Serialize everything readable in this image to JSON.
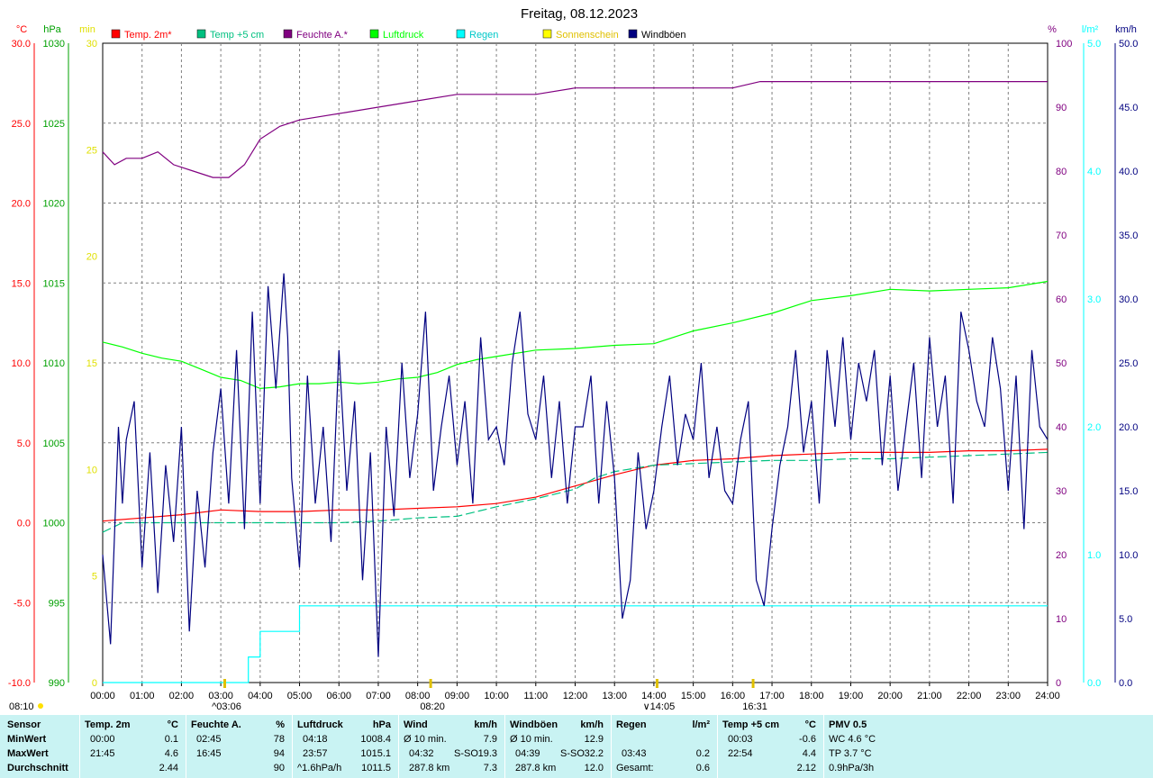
{
  "chart_data": {
    "type": "line",
    "title": "Freitag, 08.12.2023",
    "x_ticks": [
      "00:00",
      "01:00",
      "02:00",
      "03:00",
      "04:00",
      "05:00",
      "06:00",
      "07:00",
      "08:00",
      "09:00",
      "10:00",
      "11:00",
      "12:00",
      "13:00",
      "14:00",
      "15:00",
      "16:00",
      "17:00",
      "18:00",
      "19:00",
      "20:00",
      "21:00",
      "22:00",
      "23:00",
      "24:00"
    ],
    "xlim": [
      0,
      24
    ],
    "axes": {
      "temp": {
        "unit": "°C",
        "color": "#ff0000",
        "ylim": [
          -10,
          30
        ],
        "ticks": [
          "30.0",
          "25.0",
          "20.0",
          "15.0",
          "10.0",
          "5.0",
          "0.0",
          "-5.0",
          "-10.0"
        ]
      },
      "pressure": {
        "unit": "hPa",
        "color": "#00a000",
        "ylim": [
          990,
          1030
        ],
        "ticks": [
          "1030",
          "1025",
          "1020",
          "1015",
          "1010",
          "1005",
          "1000",
          "995",
          "990"
        ]
      },
      "sunshine": {
        "unit": "min",
        "color": "#e0e000",
        "ylim": [
          0,
          30
        ],
        "ticks": [
          "30",
          "25",
          "20",
          "15",
          "10",
          "5",
          "0"
        ]
      },
      "humidity": {
        "unit": "%",
        "color": "#800080",
        "ylim": [
          0,
          100
        ],
        "ticks": [
          "100",
          "90",
          "80",
          "70",
          "60",
          "50",
          "40",
          "30",
          "20",
          "10",
          "0"
        ]
      },
      "rain": {
        "unit": "l/m²",
        "color": "#00ffff",
        "ylim": [
          0,
          5
        ],
        "ticks": [
          "5.0",
          "4.0",
          "3.0",
          "2.0",
          "1.0",
          "0.0"
        ]
      },
      "wind": {
        "unit": "km/h",
        "color": "#000080",
        "ylim": [
          0,
          50
        ],
        "ticks": [
          "50.0",
          "45.0",
          "40.0",
          "35.0",
          "30.0",
          "25.0",
          "20.0",
          "15.0",
          "10.0",
          "5.0",
          "0.0"
        ]
      }
    },
    "legend": [
      {
        "label": "Temp. 2m*",
        "color": "#ff0000"
      },
      {
        "label": "Temp +5 cm",
        "color": "#00c080"
      },
      {
        "label": "Feuchte A.*",
        "color": "#800080"
      },
      {
        "label": "Luftdruck",
        "color": "#00ff00"
      },
      {
        "label": "Regen",
        "color": "#00ffff"
      },
      {
        "label": "Sonnenschein",
        "color": "#ffff00"
      },
      {
        "label": "Windböen",
        "color": "#000080"
      }
    ],
    "series": [
      {
        "name": "Temp. 2m*",
        "axis": "temp",
        "color": "#ff0000",
        "x": [
          0,
          1,
          2,
          3,
          4,
          5,
          6,
          7,
          8,
          9,
          10,
          11,
          12,
          13,
          14,
          15,
          16,
          17,
          18,
          19,
          20,
          21,
          22,
          23,
          24
        ],
        "values": [
          0.1,
          0.3,
          0.5,
          0.8,
          0.7,
          0.7,
          0.8,
          0.8,
          0.9,
          1.0,
          1.2,
          1.6,
          2.3,
          3.0,
          3.6,
          3.9,
          4.0,
          4.2,
          4.3,
          4.4,
          4.4,
          4.4,
          4.5,
          4.5,
          4.6
        ]
      },
      {
        "name": "Temp +5 cm",
        "axis": "temp",
        "color": "#00c080",
        "x": [
          0,
          0.5,
          1,
          2,
          3,
          4,
          5,
          6,
          7,
          8,
          9,
          10,
          11,
          12,
          12.5,
          13,
          14,
          15,
          16,
          17,
          18,
          19,
          20,
          21,
          22,
          23,
          24
        ],
        "values": [
          -0.6,
          0.0,
          0.0,
          0.0,
          0.0,
          0.0,
          0.0,
          0.0,
          0.1,
          0.3,
          0.4,
          1.0,
          1.5,
          2.1,
          2.8,
          3.2,
          3.6,
          3.7,
          3.8,
          3.9,
          3.9,
          4.0,
          4.0,
          4.1,
          4.2,
          4.3,
          4.4
        ]
      },
      {
        "name": "Feuchte A.*",
        "axis": "humidity",
        "color": "#800080",
        "x": [
          0,
          0.3,
          0.6,
          1,
          1.4,
          1.8,
          2.3,
          2.8,
          3.2,
          3.6,
          4,
          4.5,
          5,
          6,
          7,
          8,
          9,
          10,
          11,
          12,
          13,
          14,
          15,
          16,
          16.7,
          17,
          18,
          19,
          20,
          21,
          22,
          23,
          24
        ],
        "values": [
          83,
          81,
          82,
          82,
          83,
          81,
          80,
          79,
          79,
          81,
          85,
          87,
          88,
          89,
          90,
          91,
          92,
          92,
          92,
          93,
          93,
          93,
          93,
          93,
          94,
          94,
          94,
          94,
          94,
          94,
          94,
          94,
          94
        ]
      },
      {
        "name": "Luftdruck",
        "axis": "pressure",
        "color": "#00ff00",
        "x": [
          0,
          0.5,
          1,
          1.5,
          2,
          2.5,
          3,
          3.5,
          4,
          4.5,
          5,
          5.5,
          6,
          6.5,
          7,
          7.5,
          8,
          8.5,
          9,
          9.5,
          10,
          11,
          12,
          13,
          14,
          15,
          16,
          17,
          18,
          19,
          20,
          21,
          22,
          23,
          24
        ],
        "values": [
          1011.3,
          1011.0,
          1010.6,
          1010.3,
          1010.1,
          1009.6,
          1009.1,
          1008.9,
          1008.4,
          1008.5,
          1008.7,
          1008.7,
          1008.8,
          1008.7,
          1008.8,
          1009.0,
          1009.1,
          1009.4,
          1009.9,
          1010.2,
          1010.4,
          1010.8,
          1010.9,
          1011.1,
          1011.2,
          1012.0,
          1012.5,
          1013.1,
          1013.9,
          1014.2,
          1014.6,
          1014.5,
          1014.6,
          1014.7,
          1015.1
        ]
      },
      {
        "name": "Regen",
        "axis": "rain",
        "color": "#00ffff",
        "step": true,
        "x": [
          0,
          3.7,
          3.7,
          4.0,
          4.0,
          5.0,
          5.0,
          24
        ],
        "values": [
          0,
          0,
          0.2,
          0.2,
          0.4,
          0.4,
          0.6,
          0.6
        ]
      },
      {
        "name": "Windböen",
        "axis": "wind",
        "color": "#000080",
        "x": [
          0,
          0.2,
          0.4,
          0.5,
          0.6,
          0.8,
          1,
          1.2,
          1.4,
          1.6,
          1.8,
          2,
          2.2,
          2.4,
          2.6,
          2.8,
          3,
          3.2,
          3.4,
          3.6,
          3.8,
          4,
          4.2,
          4.4,
          4.6,
          4.7,
          4.8,
          5,
          5.2,
          5.4,
          5.6,
          5.8,
          6,
          6.2,
          6.4,
          6.6,
          6.8,
          7,
          7.2,
          7.4,
          7.6,
          7.8,
          8,
          8.2,
          8.4,
          8.6,
          8.8,
          9,
          9.2,
          9.4,
          9.6,
          9.8,
          10,
          10.2,
          10.4,
          10.6,
          10.8,
          11,
          11.2,
          11.4,
          11.6,
          11.8,
          12,
          12.2,
          12.4,
          12.6,
          12.8,
          13,
          13.2,
          13.4,
          13.6,
          13.8,
          14,
          14.2,
          14.4,
          14.6,
          14.8,
          15,
          15.2,
          15.4,
          15.6,
          15.8,
          16,
          16.2,
          16.4,
          16.6,
          16.8,
          17,
          17.2,
          17.4,
          17.6,
          17.8,
          18,
          18.2,
          18.4,
          18.6,
          18.8,
          19,
          19.2,
          19.4,
          19.6,
          19.8,
          20,
          20.2,
          20.4,
          20.6,
          20.8,
          21,
          21.2,
          21.4,
          21.6,
          21.8,
          22,
          22.2,
          22.4,
          22.6,
          22.8,
          23,
          23.2,
          23.4,
          23.6,
          23.8,
          24
        ],
        "values": [
          10,
          3,
          20,
          14,
          19,
          22,
          9,
          18,
          7,
          17,
          11,
          20,
          4,
          15,
          9,
          18,
          23,
          14,
          26,
          12,
          29,
          14,
          31,
          23,
          32,
          27,
          16,
          9,
          24,
          14,
          20,
          11,
          26,
          15,
          22,
          8,
          18,
          2,
          20,
          13,
          25,
          16,
          21,
          29,
          15,
          20,
          24,
          17,
          22,
          14,
          27,
          19,
          20,
          17,
          25,
          29,
          21,
          19,
          24,
          16,
          22,
          14,
          20,
          20,
          24,
          14,
          22,
          16,
          5,
          8,
          18,
          12,
          15,
          20,
          24,
          17,
          21,
          19,
          25,
          16,
          20,
          15,
          14,
          19,
          22,
          8,
          6,
          12,
          17,
          20,
          26,
          18,
          22,
          14,
          26,
          20,
          27,
          19,
          25,
          22,
          26,
          17,
          24,
          15,
          20,
          25,
          16,
          27,
          20,
          24,
          14,
          29,
          26,
          22,
          20,
          27,
          23,
          15,
          24,
          12,
          26,
          20,
          19
        ]
      }
    ],
    "markers": {
      "bottom": [
        {
          "label": "^03:06",
          "time": 3.1
        },
        {
          "label": "08:20",
          "time": 8.33
        },
        {
          "label": "∨14:05",
          "time": 14.08
        },
        {
          "label": "16:31",
          "time": 16.52
        }
      ],
      "sun_left": "08:10"
    }
  },
  "stats": {
    "sensor": {
      "title": "Sensor",
      "rows": [
        "MinWert",
        "MaxWert",
        "Durchschnitt"
      ]
    },
    "temp2m": {
      "title": "Temp. 2m",
      "unit": "°C",
      "min_time": "00:00",
      "min_val": "0.1",
      "max_time": "21:45",
      "max_val": "4.6",
      "avg": "2.44"
    },
    "humidity": {
      "title": "Feuchte A.",
      "unit": "%",
      "min_time": "02:45",
      "min_val": "78",
      "max_time": "16:45",
      "max_val": "94",
      "avg": "90"
    },
    "pressure": {
      "title": "Luftdruck",
      "unit": "hPa",
      "min_time": "04:18",
      "min_val": "1008.4",
      "max_time": "23:57",
      "max_val": "1015.1",
      "avg_label": "^1.6hPa/h",
      "avg": "1011.5"
    },
    "wind": {
      "title": "Wind",
      "unit": "km/h",
      "r1_label": "Ø 10 min.",
      "r1_val": "7.9",
      "r2_time": "04:32",
      "r2_dir": "S-SO",
      "r2_val": "19.3",
      "r3_label": "287.8 km",
      "r3_val": "7.3"
    },
    "gust": {
      "title": "Windböen",
      "unit": "km/h",
      "r1_label": "Ø 10 min.",
      "r1_val": "12.9",
      "r2_time": "04:39",
      "r2_dir": "S-SO",
      "r2_val": "32.2",
      "r3_label": "287.8 km",
      "r3_val": "12.0"
    },
    "rain": {
      "title": "Regen",
      "unit": "l/m²",
      "r2_time": "03:43",
      "r2_val": "0.2",
      "r3_label": "Gesamt:",
      "r3_val": "0.6"
    },
    "temp5": {
      "title": "Temp +5 cm",
      "unit": "°C",
      "min_time": "00:03",
      "min_val": "-0.6",
      "max_time": "22:54",
      "max_val": "4.4",
      "avg": "2.12"
    },
    "pmv": {
      "title": "PMV 0.5",
      "r1": "WC 4.6 °C",
      "r2": "TP 3.7 °C",
      "r3": "0.9hPa/3h"
    }
  }
}
